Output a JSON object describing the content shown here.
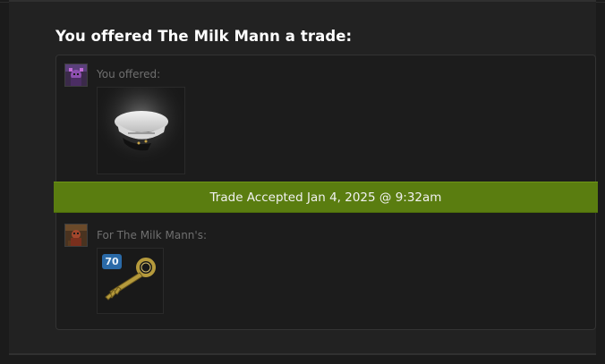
{
  "trade": {
    "headline": "You offered The Milk Mann a trade:",
    "you_offered_label": "You offered:",
    "for_label": "For The Milk Mann's:",
    "status": "Trade Accepted Jan 4, 2025 @ 9:32am"
  },
  "items": {
    "offered": [
      {
        "icon": "sailor-cap-icon"
      }
    ],
    "received": [
      {
        "icon": "crate-key-icon",
        "badge": "70"
      }
    ]
  },
  "colors": {
    "status_green": "#5a7d10",
    "badge_blue": "#2a6aa8",
    "panel_bg": "#1c1c1c"
  }
}
